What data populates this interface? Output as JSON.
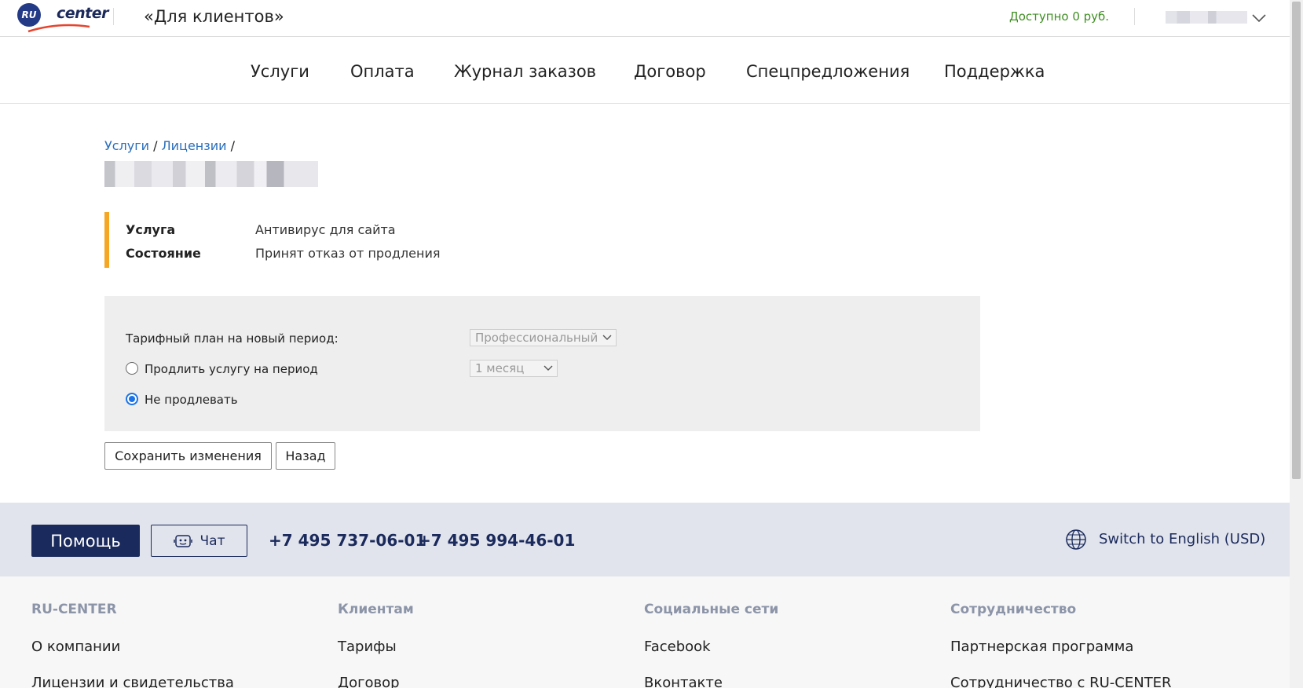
{
  "header": {
    "logo_text": "center",
    "logo_badge": "RU",
    "site_title": "«Для клиентов»",
    "balance": "Доступно 0 руб."
  },
  "nav": {
    "items": [
      "Услуги",
      "Оплата",
      "Журнал заказов",
      "Договор",
      "Спецпредложения",
      "Поддержка"
    ]
  },
  "breadcrumb": {
    "level1": "Услуги",
    "sep1": "/",
    "level2": "Лицензии",
    "sep2": "/"
  },
  "info": {
    "service_label": "Услуга",
    "service_value": "Антивирус для сайта",
    "status_label": "Состояние",
    "status_value": "Принят отказ от продления"
  },
  "form": {
    "plan_label": "Тарифный план на новый период:",
    "plan_value": "Профессиональный",
    "extend_label": "Продлить услугу на период",
    "period_value": "1 месяц",
    "no_extend_label": "Не продлевать",
    "selected_option": "no_extend"
  },
  "buttons": {
    "save": "Сохранить изменения",
    "back": "Назад"
  },
  "footer": {
    "help": "Помощь",
    "chat": "Чат",
    "phone1": "+7 495 737-06-01",
    "phone2": "+7 495 994-46-01",
    "lang": "Switch to English (USD)",
    "columns": [
      {
        "title": "RU-CENTER",
        "links": [
          "О компании",
          "Лицензии и свидетельства"
        ]
      },
      {
        "title": "Клиентам",
        "links": [
          "Тарифы",
          "Договор"
        ]
      },
      {
        "title": "Социальные сети",
        "links": [
          "Facebook",
          "Вконтакте"
        ]
      },
      {
        "title": "Сотрудничество",
        "links": [
          "Партнерская программа",
          "Сотрудничество с RU-CENTER"
        ]
      }
    ]
  },
  "colors": {
    "accent_orange": "#f5a623",
    "link_blue": "#2a6ebb",
    "balance_green": "#3f8f23",
    "brand_navy": "#1b2a5c"
  }
}
